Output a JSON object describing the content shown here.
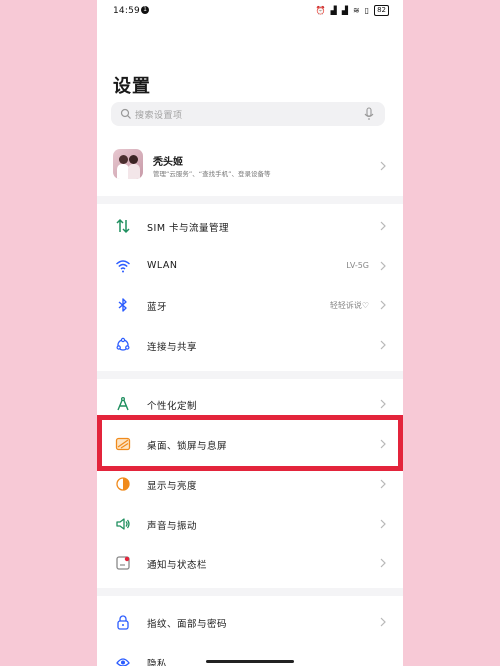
{
  "status_bar": {
    "time": "14:59",
    "notification_badge": "1",
    "icons": [
      "alarm-icon",
      "signal-icon",
      "signal-icon",
      "wifi-icon",
      "vibrate-icon"
    ],
    "battery": "82"
  },
  "header": {
    "title": "设置"
  },
  "search": {
    "placeholder": "搜索设置项"
  },
  "profile": {
    "name": "秃头姬",
    "subtitle": "管理“云服务”、“查找手机”、登录设备等"
  },
  "groups": [
    {
      "items": [
        {
          "label": "SIM 卡与流量管理",
          "value": "",
          "icon": "sim-data-icon",
          "color": "#1f8f5f"
        },
        {
          "label": "WLAN",
          "value": "LV-5G",
          "icon": "wifi-icon",
          "color": "#2b5cff"
        },
        {
          "label": "蓝牙",
          "value": "轻轻诉说♡",
          "icon": "bluetooth-icon",
          "color": "#2b5cff"
        },
        {
          "label": "连接与共享",
          "value": "",
          "icon": "share-connection-icon",
          "color": "#2b5cff"
        }
      ]
    },
    {
      "items": [
        {
          "label": "个性化定制",
          "value": "",
          "icon": "personalize-icon",
          "color": "#1f8f5f"
        },
        {
          "label": "桌面、锁屏与息屏",
          "value": "",
          "icon": "wallpaper-icon",
          "color": "#f08a1c",
          "highlighted": true
        },
        {
          "label": "显示与亮度",
          "value": "",
          "icon": "brightness-icon",
          "color": "#f08a1c"
        },
        {
          "label": "声音与振动",
          "value": "",
          "icon": "sound-icon",
          "color": "#1f8f5f"
        },
        {
          "label": "通知与状态栏",
          "value": "",
          "icon": "notification-icon",
          "color": "#e3243b"
        }
      ]
    },
    {
      "items": [
        {
          "label": "指纹、面部与密码",
          "value": "",
          "icon": "lock-icon",
          "color": "#2b5cff"
        },
        {
          "label": "隐私",
          "value": "",
          "icon": "privacy-icon",
          "color": "#2b5cff"
        }
      ]
    }
  ],
  "colors": {
    "highlight_border": "#e3243b",
    "background": "#f7c9d6"
  }
}
